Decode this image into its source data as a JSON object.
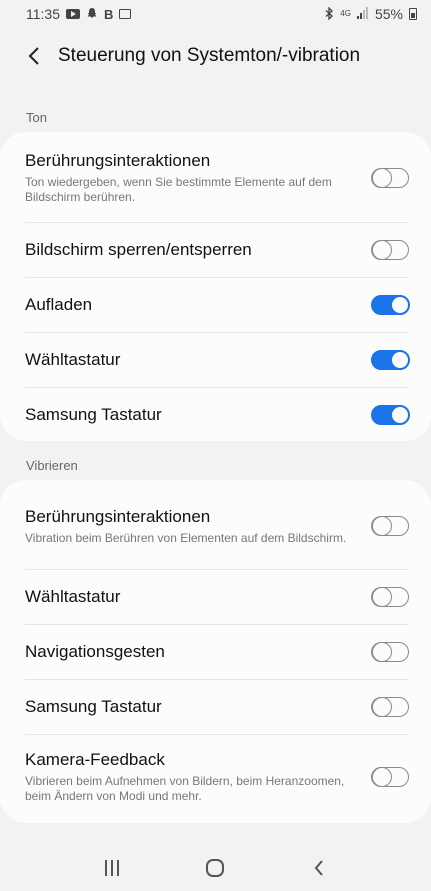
{
  "status_bar": {
    "time": "11:35",
    "notif_b": "B",
    "network": "4G",
    "battery": "55%"
  },
  "header": {
    "title": "Steuerung von Systemton/-vibration"
  },
  "sections": {
    "ton": {
      "label": "Ton",
      "items": [
        {
          "title": "Berührungsinteraktionen",
          "subtitle": "Ton wiedergeben, wenn Sie bestimmte Elemente auf dem Bildschirm berühren.",
          "on": false
        },
        {
          "title": "Bildschirm sperren/entsperren",
          "on": false
        },
        {
          "title": "Aufladen",
          "on": true
        },
        {
          "title": "Wähltastatur",
          "on": true
        },
        {
          "title": "Samsung Tastatur",
          "on": true
        }
      ]
    },
    "vibrieren": {
      "label": "Vibrieren",
      "items": [
        {
          "title": "Berührungsinteraktionen",
          "subtitle": "Vibration beim Berühren von Elementen auf dem Bildschirm.",
          "on": false
        },
        {
          "title": "Wähltastatur",
          "on": false
        },
        {
          "title": "Navigationsgesten",
          "on": false
        },
        {
          "title": "Samsung Tastatur",
          "on": false
        },
        {
          "title": "Kamera-Feedback",
          "subtitle": "Vibrieren beim Aufnehmen von Bildern, beim Heranzoomen, beim Ändern von Modi und mehr.",
          "on": false
        }
      ]
    }
  },
  "colors": {
    "accent": "#1b73e8",
    "background": "#f2f2f2",
    "card": "#fcfcfc"
  },
  "icons": {
    "back": "back-arrow-icon",
    "recents": "recents-icon",
    "home": "home-icon",
    "nav_back": "nav-back-icon"
  }
}
